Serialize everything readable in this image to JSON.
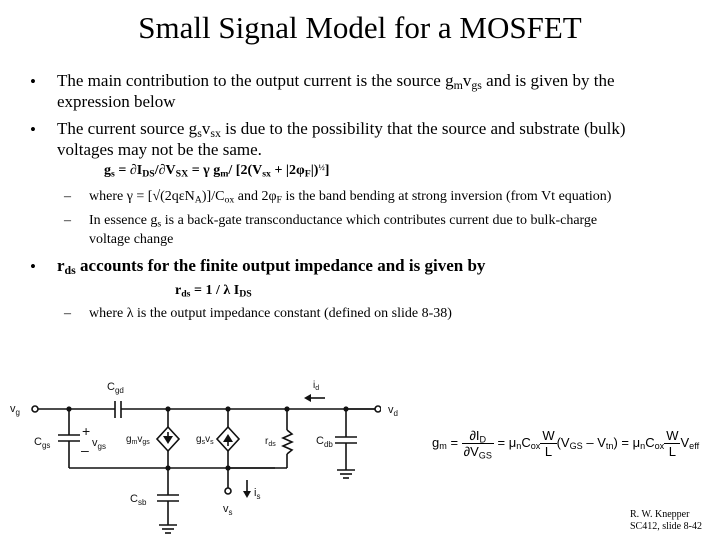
{
  "title": "Small Signal Model for a MOSFET",
  "bullets": [
    {
      "symbol": "•",
      "line1_a": "The main contribution to the output current is the source g",
      "line1_sub1": "m",
      "line1_b": "v",
      "line1_sub2": "gs",
      "line1_c": " and is given by the",
      "line2": "expression below"
    },
    {
      "symbol": "•",
      "line1_a": "The current source g",
      "line1_sub1": "s",
      "line1_b": "v",
      "line1_sub2": "sx",
      "line1_c": " is due to the possibility that the source and substrate (bulk)",
      "line2": "voltages may not be the same."
    },
    {
      "symbol": "•",
      "line1_a": "r",
      "line1_sub1": "ds",
      "line1_c": " accounts for the finite output impedance and is given by"
    }
  ],
  "gs_equation": {
    "p1": "g",
    "p1_sub": "s",
    "p2": " = ",
    "partial1": "∂",
    "p3": "I",
    "p3_sub": "DS",
    "p4": "/",
    "partial2": "∂",
    "p5": "V",
    "p5_sub": "SX",
    "p6": " = γ g",
    "p6_sub": "m",
    "p7": "/  [2(V",
    "p7_sub": "sx",
    "p8": " + |2φ",
    "p8_sub": "F",
    "p9": "|)",
    "p9_sup": "½",
    "p10": "]"
  },
  "sub_bullets_gs": [
    {
      "dash": "–",
      "a": "where  γ = [",
      "sqrt": "√",
      "b": "(2qεN",
      "b_sub": "A",
      "c": ")]/C",
      "c_sub": "ox",
      "d": " and 2φ",
      "d_sub": "F",
      "e": " is the band bending at strong inversion (from Vt equation)"
    },
    {
      "dash": "–",
      "a": "In essence g",
      "a_sub": "s",
      "b": " is a back-gate transconductance which contributes current due to bulk-charge",
      "line2": "voltage change"
    }
  ],
  "rds_equation": {
    "a": "r",
    "a_sub": "ds",
    "b": " = 1 / λ I",
    "b_sub": "DS"
  },
  "sub_bullets_rds": [
    {
      "dash": "–",
      "text": "where λ is the output impedance constant (defined on slide 8-38)"
    }
  ],
  "circuit": {
    "labels": {
      "vg": "v",
      "vg_sub": "g",
      "cgd": "C",
      "cgd_sub": "gd",
      "cgs": "C",
      "cgs_sub": "gs",
      "plus": "+",
      "minus": "–",
      "vgs": "v",
      "vgs_sub": "gs",
      "gmvgs_a": "g",
      "gmvgs_sub1": "m",
      "gmvgs_b": "v",
      "gmvgs_sub2": "gs",
      "gsvs_a": "g",
      "gsvs_sub1": "s",
      "gsvs_b": "v",
      "gsvs_sub2": "s",
      "rds": "r",
      "rds_sub": "ds",
      "cdb": "C",
      "cdb_sub": "db",
      "csb": "C",
      "csb_sub": "sb",
      "id": "i",
      "id_sub": "d",
      "vd": "v",
      "vd_sub": "d",
      "is": "i",
      "is_sub": "s",
      "vs": "v",
      "vs_sub": "s"
    }
  },
  "gm_equation": {
    "lhs": "g",
    "lhs_sub": "m",
    "eq1": "=",
    "frac1_num": "∂I",
    "frac1_num_sub": "D",
    "frac1_den": "∂V",
    "frac1_den_sub": "GS",
    "eq2": "=",
    "mu": "μ",
    "mu_sub": "n",
    "cox": "C",
    "cox_sub": "ox",
    "frac2_num": "W",
    "frac2_den": "L",
    "paren": "(V",
    "paren_sub1": "GS",
    "paren_mid": " – V",
    "paren_sub2": "tn",
    "paren_end": ")",
    "eq3": "=",
    "mu2": "μ",
    "mu2_sub": "n",
    "cox2": "C",
    "cox2_sub": "ox",
    "frac3_num": "W",
    "frac3_den": "L",
    "veff": "V",
    "veff_sub": "eff"
  },
  "credit": {
    "line1": "R. W. Knepper",
    "line2": "SC412, slide 8-42"
  }
}
